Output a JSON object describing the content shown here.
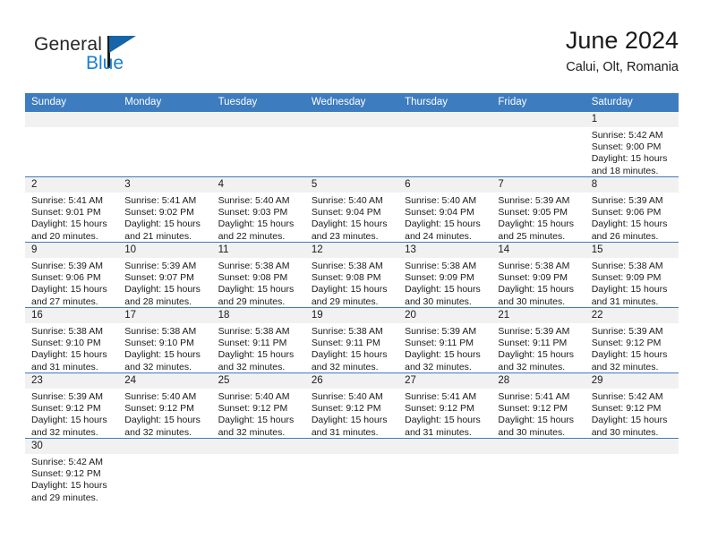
{
  "brand": {
    "name_top": "General",
    "name_bottom": "Blue",
    "accent_color": "#1a7fd4",
    "triangle_color": "#1565a8"
  },
  "header": {
    "title": "June 2024",
    "subtitle": "Calui, Olt, Romania"
  },
  "theme": {
    "header_row_bg": "#3d7cbf",
    "header_row_text": "#ffffff",
    "daynum_bg": "#f1f1f1",
    "row_divider": "#3d7cbf",
    "cell_bg": "#ffffff",
    "text": "#1a1a1a"
  },
  "labels": {
    "sunrise_prefix": "Sunrise:",
    "sunset_prefix": "Sunset:",
    "daylight_prefix": "Daylight:"
  },
  "weekdays": [
    "Sunday",
    "Monday",
    "Tuesday",
    "Wednesday",
    "Thursday",
    "Friday",
    "Saturday"
  ],
  "weeks": [
    [
      {
        "day": "",
        "lines": []
      },
      {
        "day": "",
        "lines": []
      },
      {
        "day": "",
        "lines": []
      },
      {
        "day": "",
        "lines": []
      },
      {
        "day": "",
        "lines": []
      },
      {
        "day": "",
        "lines": []
      },
      {
        "day": "1",
        "lines": [
          "Sunrise: 5:42 AM",
          "Sunset: 9:00 PM",
          "Daylight: 15 hours",
          "and 18 minutes."
        ]
      }
    ],
    [
      {
        "day": "2",
        "lines": [
          "Sunrise: 5:41 AM",
          "Sunset: 9:01 PM",
          "Daylight: 15 hours",
          "and 20 minutes."
        ]
      },
      {
        "day": "3",
        "lines": [
          "Sunrise: 5:41 AM",
          "Sunset: 9:02 PM",
          "Daylight: 15 hours",
          "and 21 minutes."
        ]
      },
      {
        "day": "4",
        "lines": [
          "Sunrise: 5:40 AM",
          "Sunset: 9:03 PM",
          "Daylight: 15 hours",
          "and 22 minutes."
        ]
      },
      {
        "day": "5",
        "lines": [
          "Sunrise: 5:40 AM",
          "Sunset: 9:04 PM",
          "Daylight: 15 hours",
          "and 23 minutes."
        ]
      },
      {
        "day": "6",
        "lines": [
          "Sunrise: 5:40 AM",
          "Sunset: 9:04 PM",
          "Daylight: 15 hours",
          "and 24 minutes."
        ]
      },
      {
        "day": "7",
        "lines": [
          "Sunrise: 5:39 AM",
          "Sunset: 9:05 PM",
          "Daylight: 15 hours",
          "and 25 minutes."
        ]
      },
      {
        "day": "8",
        "lines": [
          "Sunrise: 5:39 AM",
          "Sunset: 9:06 PM",
          "Daylight: 15 hours",
          "and 26 minutes."
        ]
      }
    ],
    [
      {
        "day": "9",
        "lines": [
          "Sunrise: 5:39 AM",
          "Sunset: 9:06 PM",
          "Daylight: 15 hours",
          "and 27 minutes."
        ]
      },
      {
        "day": "10",
        "lines": [
          "Sunrise: 5:39 AM",
          "Sunset: 9:07 PM",
          "Daylight: 15 hours",
          "and 28 minutes."
        ]
      },
      {
        "day": "11",
        "lines": [
          "Sunrise: 5:38 AM",
          "Sunset: 9:08 PM",
          "Daylight: 15 hours",
          "and 29 minutes."
        ]
      },
      {
        "day": "12",
        "lines": [
          "Sunrise: 5:38 AM",
          "Sunset: 9:08 PM",
          "Daylight: 15 hours",
          "and 29 minutes."
        ]
      },
      {
        "day": "13",
        "lines": [
          "Sunrise: 5:38 AM",
          "Sunset: 9:09 PM",
          "Daylight: 15 hours",
          "and 30 minutes."
        ]
      },
      {
        "day": "14",
        "lines": [
          "Sunrise: 5:38 AM",
          "Sunset: 9:09 PM",
          "Daylight: 15 hours",
          "and 30 minutes."
        ]
      },
      {
        "day": "15",
        "lines": [
          "Sunrise: 5:38 AM",
          "Sunset: 9:09 PM",
          "Daylight: 15 hours",
          "and 31 minutes."
        ]
      }
    ],
    [
      {
        "day": "16",
        "lines": [
          "Sunrise: 5:38 AM",
          "Sunset: 9:10 PM",
          "Daylight: 15 hours",
          "and 31 minutes."
        ]
      },
      {
        "day": "17",
        "lines": [
          "Sunrise: 5:38 AM",
          "Sunset: 9:10 PM",
          "Daylight: 15 hours",
          "and 32 minutes."
        ]
      },
      {
        "day": "18",
        "lines": [
          "Sunrise: 5:38 AM",
          "Sunset: 9:11 PM",
          "Daylight: 15 hours",
          "and 32 minutes."
        ]
      },
      {
        "day": "19",
        "lines": [
          "Sunrise: 5:38 AM",
          "Sunset: 9:11 PM",
          "Daylight: 15 hours",
          "and 32 minutes."
        ]
      },
      {
        "day": "20",
        "lines": [
          "Sunrise: 5:39 AM",
          "Sunset: 9:11 PM",
          "Daylight: 15 hours",
          "and 32 minutes."
        ]
      },
      {
        "day": "21",
        "lines": [
          "Sunrise: 5:39 AM",
          "Sunset: 9:11 PM",
          "Daylight: 15 hours",
          "and 32 minutes."
        ]
      },
      {
        "day": "22",
        "lines": [
          "Sunrise: 5:39 AM",
          "Sunset: 9:12 PM",
          "Daylight: 15 hours",
          "and 32 minutes."
        ]
      }
    ],
    [
      {
        "day": "23",
        "lines": [
          "Sunrise: 5:39 AM",
          "Sunset: 9:12 PM",
          "Daylight: 15 hours",
          "and 32 minutes."
        ]
      },
      {
        "day": "24",
        "lines": [
          "Sunrise: 5:40 AM",
          "Sunset: 9:12 PM",
          "Daylight: 15 hours",
          "and 32 minutes."
        ]
      },
      {
        "day": "25",
        "lines": [
          "Sunrise: 5:40 AM",
          "Sunset: 9:12 PM",
          "Daylight: 15 hours",
          "and 32 minutes."
        ]
      },
      {
        "day": "26",
        "lines": [
          "Sunrise: 5:40 AM",
          "Sunset: 9:12 PM",
          "Daylight: 15 hours",
          "and 31 minutes."
        ]
      },
      {
        "day": "27",
        "lines": [
          "Sunrise: 5:41 AM",
          "Sunset: 9:12 PM",
          "Daylight: 15 hours",
          "and 31 minutes."
        ]
      },
      {
        "day": "28",
        "lines": [
          "Sunrise: 5:41 AM",
          "Sunset: 9:12 PM",
          "Daylight: 15 hours",
          "and 30 minutes."
        ]
      },
      {
        "day": "29",
        "lines": [
          "Sunrise: 5:42 AM",
          "Sunset: 9:12 PM",
          "Daylight: 15 hours",
          "and 30 minutes."
        ]
      }
    ],
    [
      {
        "day": "30",
        "lines": [
          "Sunrise: 5:42 AM",
          "Sunset: 9:12 PM",
          "Daylight: 15 hours",
          "and 29 minutes."
        ]
      },
      {
        "day": "",
        "lines": []
      },
      {
        "day": "",
        "lines": []
      },
      {
        "day": "",
        "lines": []
      },
      {
        "day": "",
        "lines": []
      },
      {
        "day": "",
        "lines": []
      },
      {
        "day": "",
        "lines": []
      }
    ]
  ]
}
